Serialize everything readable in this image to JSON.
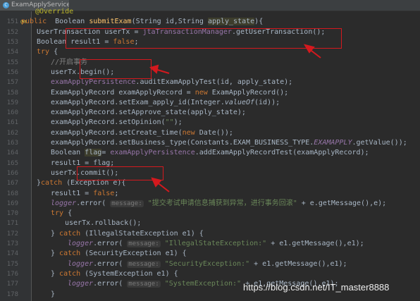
{
  "editor": {
    "tab_title": "ExamApplyServiceImpl.java",
    "tab_icon": "java-file-icon"
  },
  "lines": [
    {
      "num": "",
      "text": "@Override"
    },
    {
      "num": "151",
      "text": "public  Boolean submitExam(String id,String apply_state){"
    },
    {
      "num": "152",
      "text": "UserTransaction userTx = jtaTransactionManager.getUserTransaction();"
    },
    {
      "num": "153",
      "text": "Boolean result1 = false;"
    },
    {
      "num": "154",
      "text": "try {"
    },
    {
      "num": "155",
      "text": "//开启事务"
    },
    {
      "num": "156",
      "text": "userTx.begin();"
    },
    {
      "num": "157",
      "text": "examApplyPersistence.auditExamApplyTest(id, apply_state);"
    },
    {
      "num": "158",
      "text": "ExamApplyRecord examApplyRecord = new ExamApplyRecord();"
    },
    {
      "num": "159",
      "text": "examApplyRecord.setExam_apply_id(Integer.valueOf(id));"
    },
    {
      "num": "160",
      "text": "examApplyRecord.setApprove_state(apply_state);"
    },
    {
      "num": "161",
      "text": "examApplyRecord.setOpinion(\"\");"
    },
    {
      "num": "162",
      "text": "examApplyRecord.setCreate_time(new Date());"
    },
    {
      "num": "163",
      "text": "examApplyRecord.setBusiness_type(Constants.EXAM_BUSINESS_TYPE.EXAMAPPLY.getValue());"
    },
    {
      "num": "164",
      "text": "Boolean flag= examApplyPersistence.addExamApplyRecordTest(examApplyRecord);"
    },
    {
      "num": "165",
      "text": "result1 = flag;"
    },
    {
      "num": "166",
      "text": "userTx.commit();"
    },
    {
      "num": "167",
      "text": "}catch (Exception e){"
    },
    {
      "num": "168",
      "text": "result1 = false;"
    },
    {
      "num": "169",
      "text": "logger.error( message: \"提交考试申请信息捕获到异常，进行事务回滚\" + e.getMessage(),e);"
    },
    {
      "num": "170",
      "text": "try {"
    },
    {
      "num": "171",
      "text": "userTx.rollback();"
    },
    {
      "num": "172",
      "text": "} catch (IllegalStateException e1) {"
    },
    {
      "num": "173",
      "text": "logger.error( message: \"IllegalStateException:\" + e1.getMessage(),e1);"
    },
    {
      "num": "174",
      "text": "} catch (SecurityException e1) {"
    },
    {
      "num": "175",
      "text": "logger.error( message: \"SecurityException:\" + e1.getMessage(),e1);"
    },
    {
      "num": "176",
      "text": "} catch (SystemException e1) {"
    },
    {
      "num": "177",
      "text": "logger.error( message: \"SystemException:\" + e1.getMessage(),e1);"
    },
    {
      "num": "178",
      "text": "}"
    }
  ],
  "watermark": "https://blog.csdn.net/IT_master8888",
  "colors": {
    "background": "#2b2b2b",
    "keyword": "#cc7832",
    "string": "#6a8759",
    "field": "#9876aa",
    "annotation_red": "#d4191e"
  }
}
